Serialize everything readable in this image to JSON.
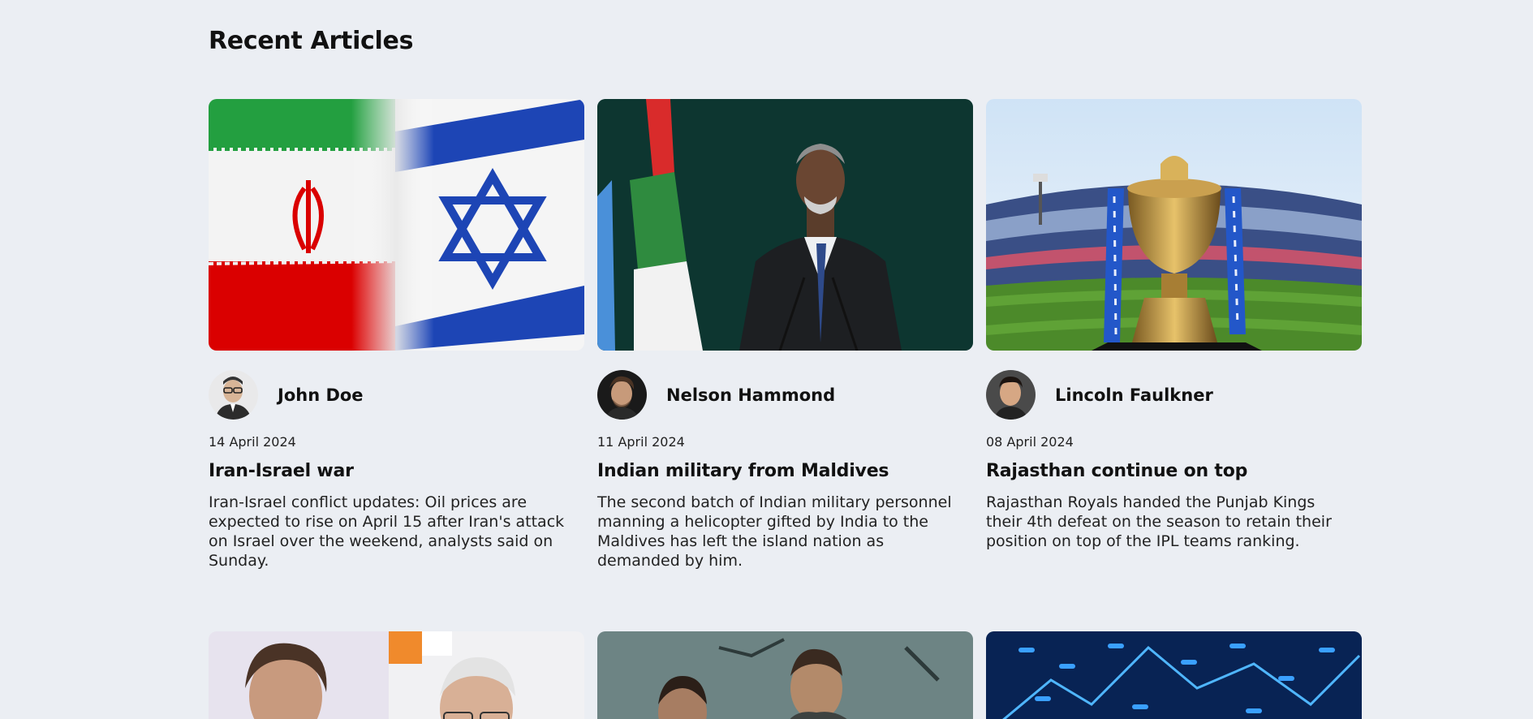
{
  "section": {
    "title": "Recent Articles"
  },
  "articles": [
    {
      "author": "John Doe",
      "date": "14 April 2024",
      "title": "Iran-Israel war",
      "excerpt": "Iran-Israel conflict updates: Oil prices are expected to rise on April 15 after Iran's attack on Israel over the weekend, analysts said on Sunday."
    },
    {
      "author": "Nelson Hammond",
      "date": "11 April 2024",
      "title": "Indian military from Maldives",
      "excerpt": "The second batch of Indian military personnel manning a helicopter gifted by India to the Maldives has left the island nation as demanded by him."
    },
    {
      "author": "Lincoln Faulkner",
      "date": "08 April 2024",
      "title": "Rajasthan continue on top",
      "excerpt": "Rajasthan Royals handed the Punjab Kings their 4th defeat on the season to retain their position on top of the IPL teams ranking."
    }
  ],
  "colors": {
    "background": "#ebeef3",
    "text": "#111111"
  }
}
